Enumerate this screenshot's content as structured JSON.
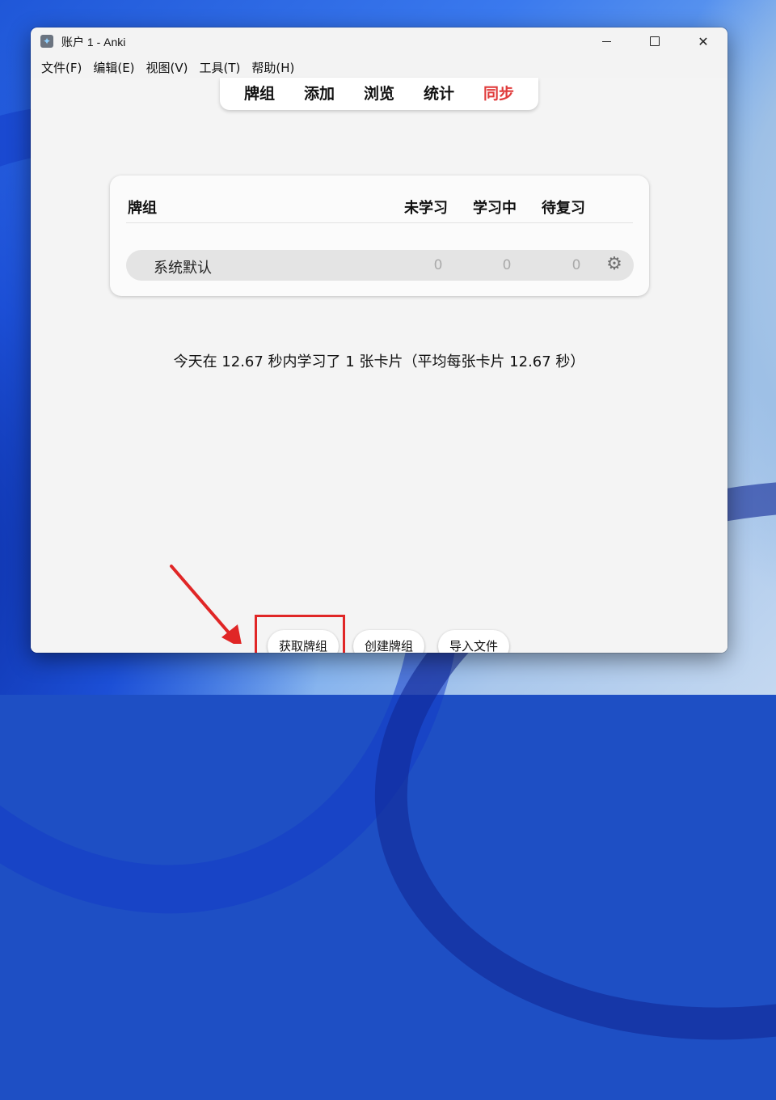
{
  "window": {
    "title": "账户 1 - Anki"
  },
  "menubar": {
    "items": [
      "文件(F)",
      "编辑(E)",
      "视图(V)",
      "工具(T)",
      "帮助(H)"
    ]
  },
  "toolbar": {
    "tabs": [
      "牌组",
      "添加",
      "浏览",
      "统计",
      "同步"
    ],
    "sync_color": "#e03b3b"
  },
  "deck_list": {
    "headers": {
      "name": "牌组",
      "new": "未学习",
      "learning": "学习中",
      "due": "待复习"
    },
    "rows": [
      {
        "name": "系统默认",
        "new": "0",
        "learning": "0",
        "due": "0",
        "options_icon": "gear-icon"
      }
    ]
  },
  "stats_text": "今天在 12.67 秒内学习了 1 张卡片（平均每张卡片 12.67 秒）",
  "buttons": {
    "get_decks": "获取牌组",
    "create_deck": "创建牌组",
    "import_file": "导入文件"
  },
  "annotation": {
    "highlight_color": "#e02626",
    "pointer_icon": "red-arrow-icon"
  }
}
